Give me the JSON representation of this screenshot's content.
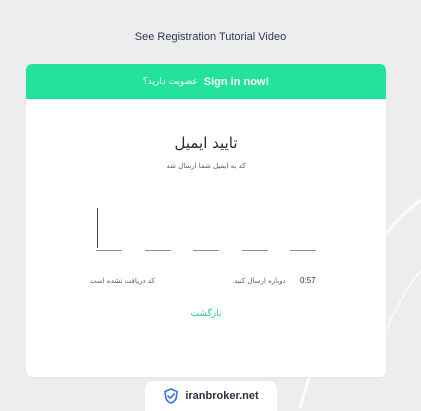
{
  "header": {
    "tutorial_link": "See Registration Tutorial Video"
  },
  "banner": {
    "question": "عضویت دارید؟",
    "signin_label": "Sign in now!",
    "color": "#22e29c"
  },
  "verify": {
    "title": "تایید ایمیل",
    "subtitle": "کد به ایمیل شما ارسال شد",
    "code_boxes": [
      "",
      "",
      "",
      "",
      ""
    ],
    "not_received": "کد دریافت نشده است",
    "resend": "دوباره ارسال کنید",
    "timer": "0:57",
    "back": "بازگشت"
  },
  "brand": {
    "name": "iranbroker.net",
    "icon": "check-shield-icon",
    "accent": "#3b6ef0"
  }
}
